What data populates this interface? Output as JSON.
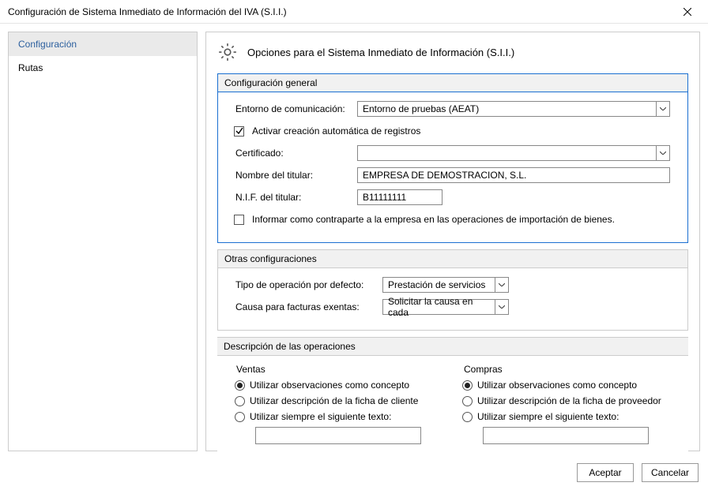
{
  "window": {
    "title": "Configuración de Sistema Inmediato de Información del IVA (S.I.I.)"
  },
  "sidebar": {
    "items": [
      {
        "label": "Configuración",
        "selected": true
      },
      {
        "label": "Rutas",
        "selected": false
      }
    ]
  },
  "header": {
    "title": "Opciones para el Sistema Inmediato de Información (S.I.I.)"
  },
  "general": {
    "legend": "Configuración general",
    "env_label": "Entorno de comunicación:",
    "env_value": "Entorno de pruebas (AEAT)",
    "auto_create_label": "Activar creación automática de registros",
    "auto_create_checked": true,
    "cert_label": "Certificado:",
    "cert_value": "",
    "holder_name_label": "Nombre del titular:",
    "holder_name_value": "EMPRESA DE DEMOSTRACION, S.L.",
    "holder_nif_label": "N.I.F. del titular:",
    "holder_nif_value": "B11111111",
    "inform_counterparty_label": "Informar como contraparte a la empresa en las operaciones de importación de bienes.",
    "inform_counterparty_checked": false
  },
  "other": {
    "legend": "Otras configuraciones",
    "op_type_label": "Tipo de operación por defecto:",
    "op_type_value": "Prestación de servicios",
    "exempt_cause_label": "Causa para facturas exentas:",
    "exempt_cause_value": "Solicitar la causa en cada"
  },
  "desc": {
    "legend": "Descripción de las operaciones",
    "sales": {
      "title": "Ventas",
      "opt1": "Utilizar observaciones como concepto",
      "opt2": "Utilizar descripción de la ficha de cliente",
      "opt3": "Utilizar siempre el siguiente texto:",
      "selected": 0,
      "free_text": ""
    },
    "purchases": {
      "title": "Compras",
      "opt1": "Utilizar observaciones como concepto",
      "opt2": "Utilizar descripción de la ficha de proveedor",
      "opt3": "Utilizar siempre el siguiente texto:",
      "selected": 0,
      "free_text": ""
    }
  },
  "buttons": {
    "ok": "Aceptar",
    "cancel": "Cancelar"
  }
}
